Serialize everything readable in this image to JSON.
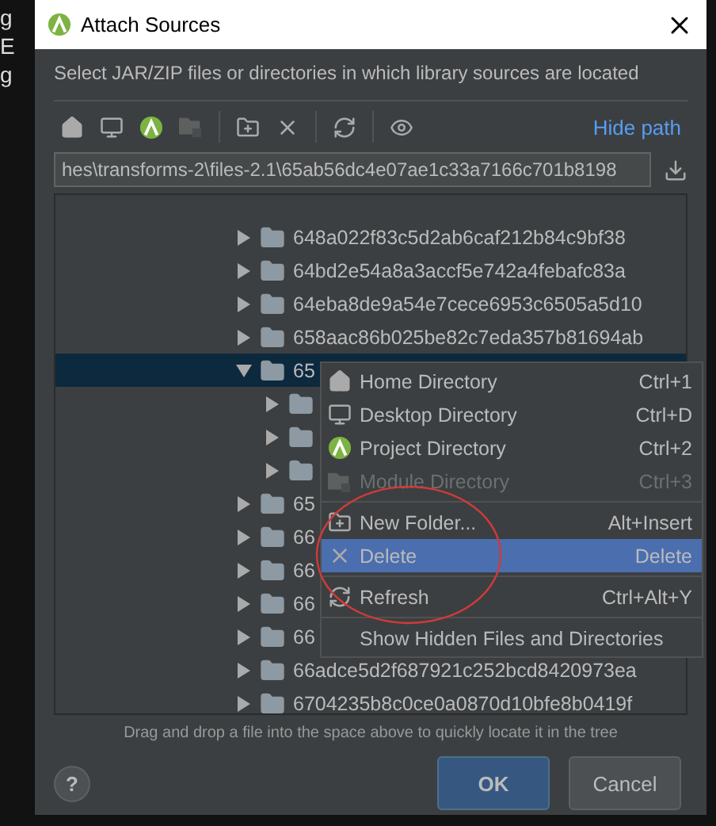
{
  "background_lines": [
    "g",
    "E",
    "g"
  ],
  "window": {
    "title": "Attach Sources"
  },
  "description": "Select JAR/ZIP files or directories in which library sources are located",
  "toolbar": [
    {
      "kind": "home",
      "disabled": false
    },
    {
      "kind": "desktop",
      "disabled": false
    },
    {
      "kind": "project",
      "disabled": false
    },
    {
      "kind": "module",
      "disabled": true
    },
    {
      "kind": "separator"
    },
    {
      "kind": "new-folder",
      "disabled": false
    },
    {
      "kind": "delete",
      "disabled": false
    },
    {
      "kind": "separator"
    },
    {
      "kind": "refresh",
      "disabled": false
    },
    {
      "kind": "separator"
    },
    {
      "kind": "hidden",
      "disabled": false
    }
  ],
  "hide_path_link": "Hide path",
  "path_field": {
    "value": "hes\\transforms-2\\files-2.1\\65ab56dc4e07ae1c33a7166c701b8198"
  },
  "tree": [
    {
      "label": "648a022f83c5d2ab6caf212b84c9bf38",
      "expanded": false,
      "selected": false
    },
    {
      "label": "64bd2e54a8a3accf5e742a4febafc83a",
      "expanded": false,
      "selected": false
    },
    {
      "label": "64eba8de9a54e7cece6953c6505a5d10",
      "expanded": false,
      "selected": false
    },
    {
      "label": "658aac86b025be82c7eda357b81694ab",
      "expanded": false,
      "selected": false
    },
    {
      "label": "65",
      "expanded": true,
      "selected": true,
      "children": [
        {
          "expanded": false,
          "selected": false
        },
        {
          "expanded": false,
          "selected": false
        },
        {
          "expanded": false,
          "selected": false
        }
      ]
    },
    {
      "label": "65",
      "expanded": false,
      "selected": false
    },
    {
      "label": "66",
      "expanded": false,
      "selected": false
    },
    {
      "label": "66",
      "expanded": false,
      "selected": false
    },
    {
      "label": "66",
      "expanded": false,
      "selected": false
    },
    {
      "label": "66",
      "expanded": false,
      "selected": false
    },
    {
      "label": "66adce5d2f687921c252bcd8420973ea",
      "expanded": false,
      "selected": false
    },
    {
      "label": "6704235b8c0ce0a0870d10bfe8b0419f",
      "expanded": false,
      "selected": false
    }
  ],
  "context_menu": [
    {
      "kind": "home",
      "label": "Home Directory",
      "shortcut": "Ctrl+1",
      "disabled": false,
      "selected": false
    },
    {
      "kind": "desktop",
      "label": "Desktop Directory",
      "shortcut": "Ctrl+D",
      "disabled": false,
      "selected": false
    },
    {
      "kind": "project",
      "label": "Project Directory",
      "shortcut": "Ctrl+2",
      "disabled": false,
      "selected": false
    },
    {
      "kind": "module",
      "label": "Module Directory",
      "shortcut": "Ctrl+3",
      "disabled": true,
      "selected": false
    },
    {
      "kind": "separator"
    },
    {
      "kind": "new-folder",
      "label": "New Folder...",
      "shortcut": "Alt+Insert",
      "disabled": false,
      "selected": false
    },
    {
      "kind": "delete",
      "label": "Delete",
      "shortcut": "Delete",
      "disabled": false,
      "selected": true
    },
    {
      "kind": "separator"
    },
    {
      "kind": "refresh",
      "label": "Refresh",
      "shortcut": "Ctrl+Alt+Y",
      "disabled": false,
      "selected": false
    },
    {
      "kind": "separator"
    },
    {
      "kind": "plain",
      "label": "Show Hidden Files and Directories",
      "disabled": false,
      "selected": false
    }
  ],
  "drop_hint": "Drag and drop a file into the space above to quickly locate it in the tree",
  "help_button": {
    "label": "?"
  },
  "buttons": [
    {
      "label": "OK",
      "kind": "primary"
    },
    {
      "label": "Cancel",
      "kind": "secondary"
    }
  ]
}
